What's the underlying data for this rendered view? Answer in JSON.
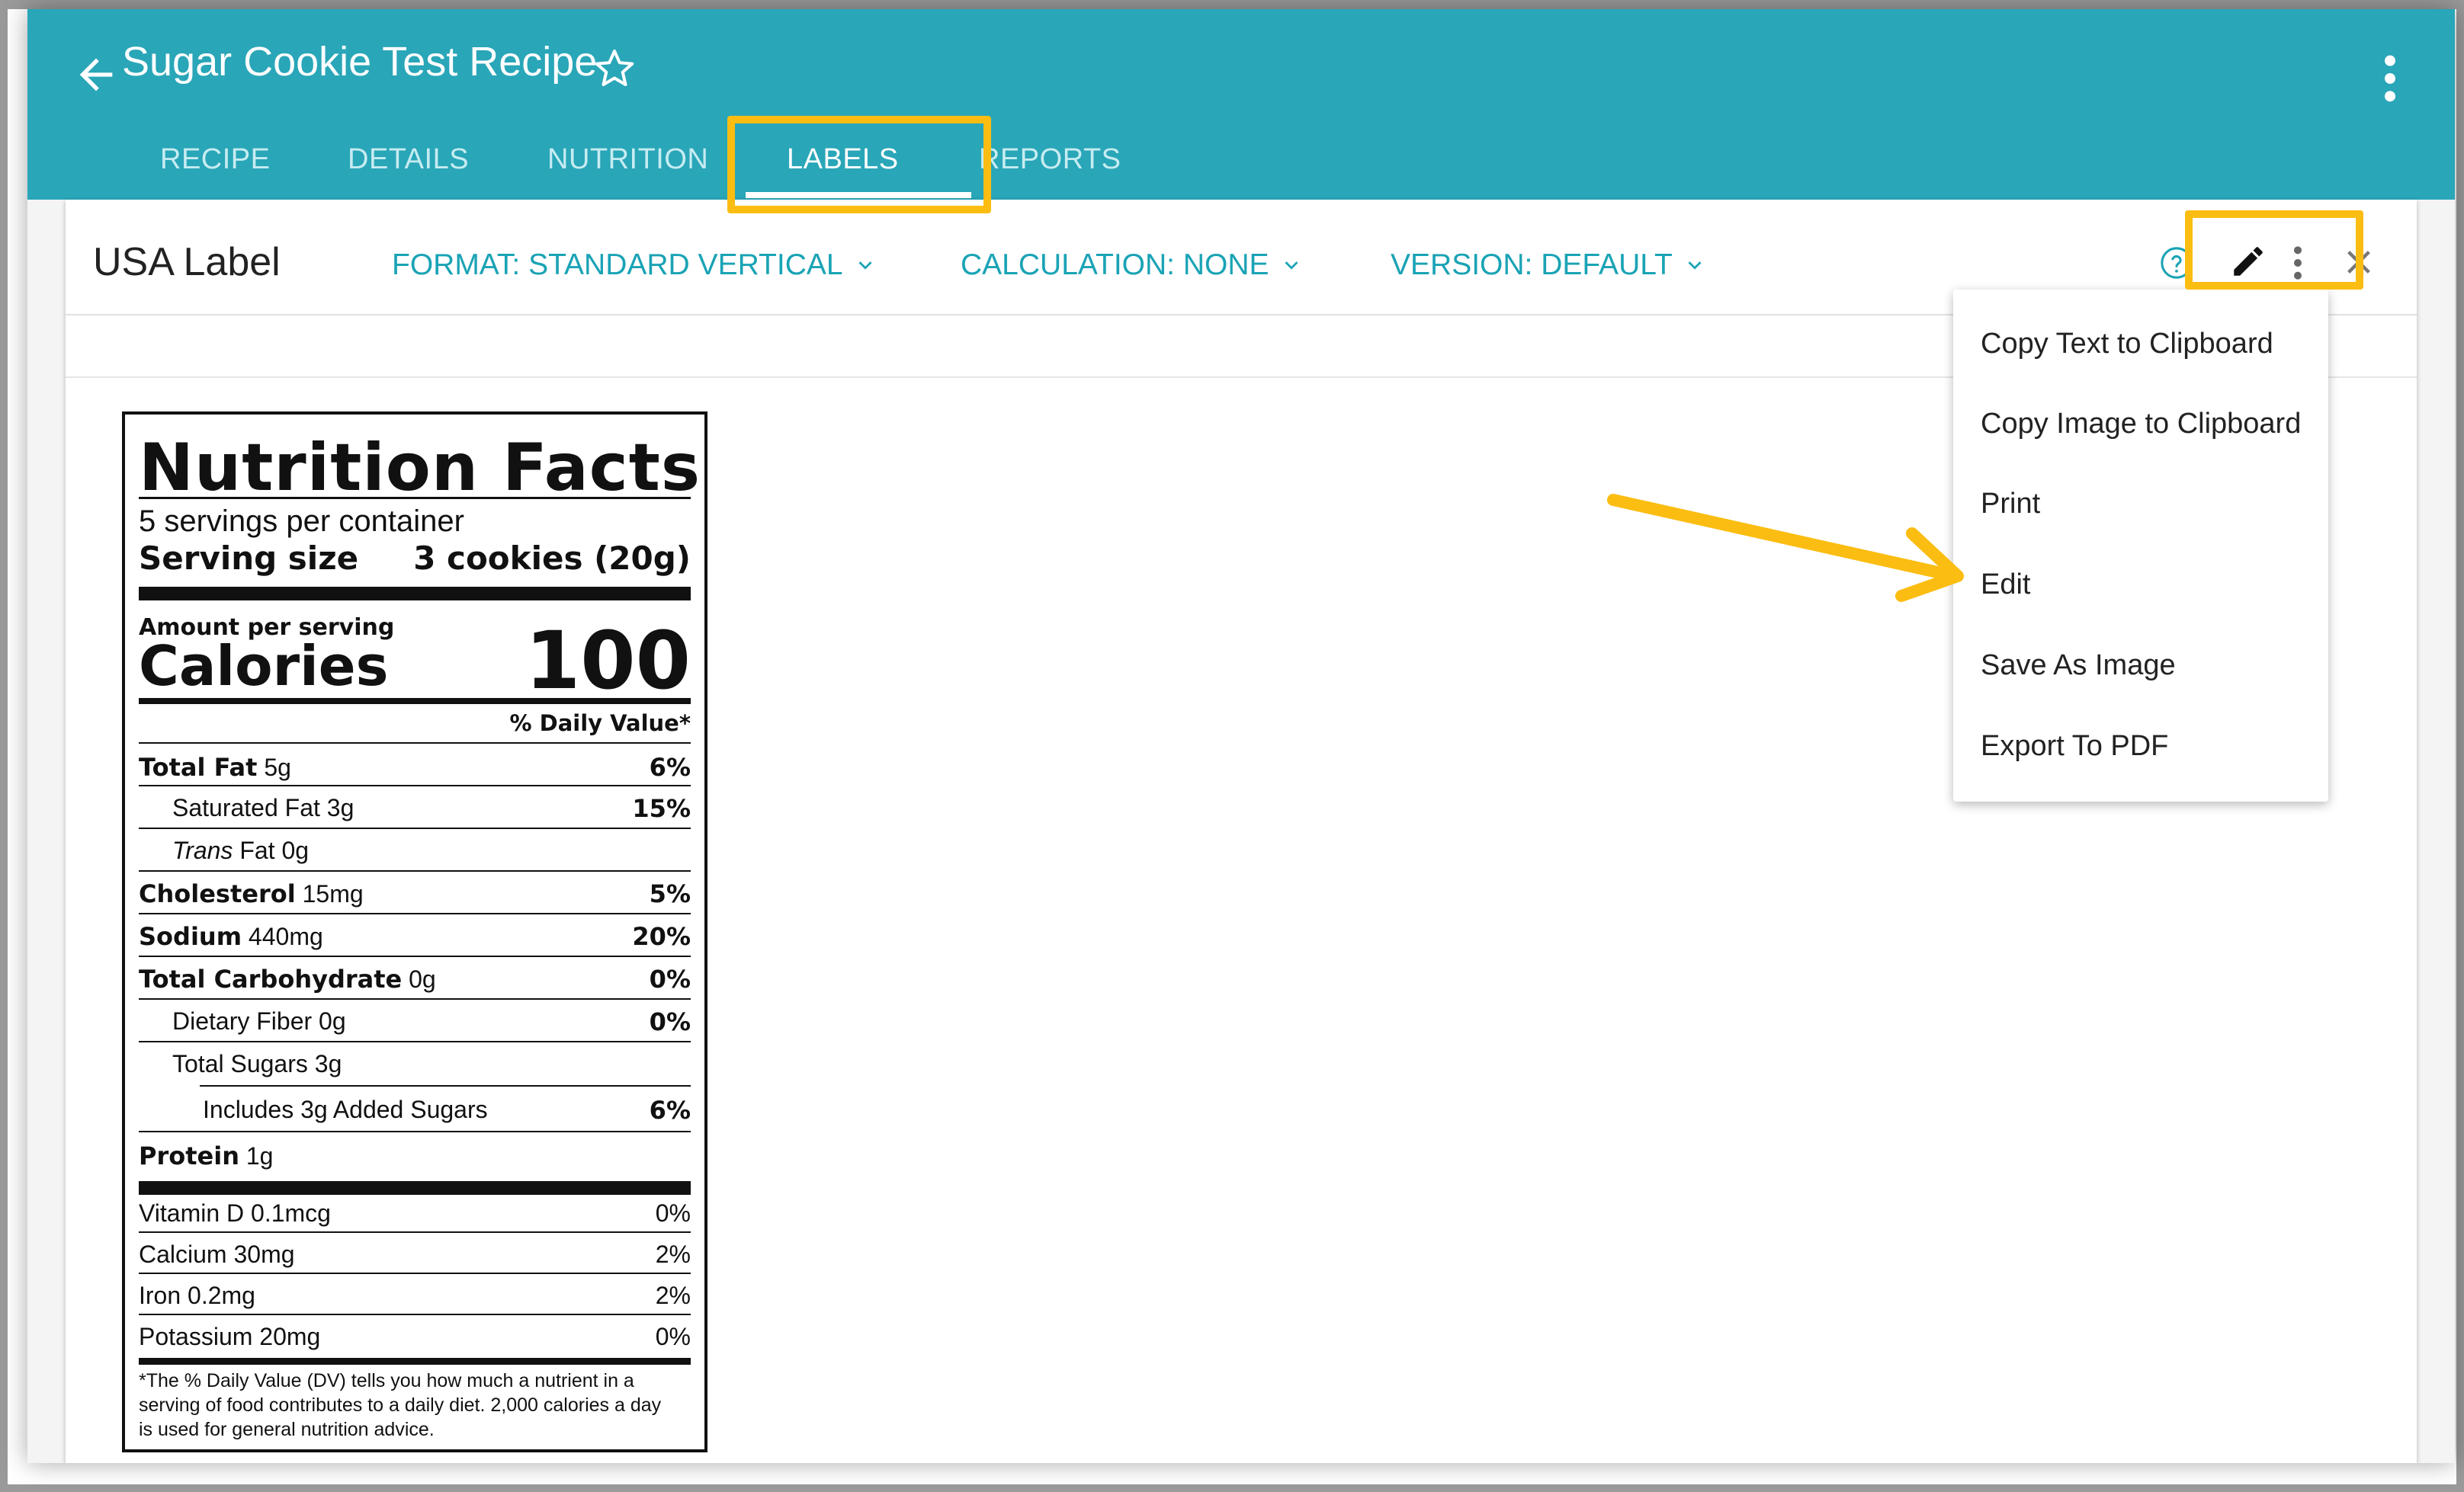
{
  "header": {
    "title": "Sugar Cookie Test Recipe",
    "tabs": [
      {
        "label": "RECIPE",
        "active": false
      },
      {
        "label": "DETAILS",
        "active": false
      },
      {
        "label": "NUTRITION",
        "active": false
      },
      {
        "label": "LABELS",
        "active": true
      },
      {
        "label": "REPORTS",
        "active": false
      }
    ]
  },
  "card": {
    "title": "USA Label",
    "format_label": "FORMAT: STANDARD VERTICAL",
    "calculation_label": "CALCULATION: NONE",
    "version_label": "VERSION: DEFAULT"
  },
  "menu": {
    "items": [
      "Copy Text to Clipboard",
      "Copy Image to Clipboard",
      "Print",
      "Edit",
      "Save As Image",
      "Export To PDF"
    ]
  },
  "label": {
    "title": "Nutrition Facts",
    "servings": "5 servings per container",
    "serving_size_label": "Serving size",
    "serving_size_value": "3 cookies (20g)",
    "amount_per_serving": "Amount per serving",
    "calories_label": "Calories",
    "calories_value": "100",
    "daily_value_header": "% Daily Value*",
    "nutrients": [
      {
        "name": "Total Fat",
        "amount": "5g",
        "dv": "6%"
      },
      {
        "name": "Saturated Fat",
        "amount": "3g",
        "dv": "15%"
      },
      {
        "name": "Trans",
        "name_rest": "Fat",
        "amount": "0g",
        "dv": ""
      },
      {
        "name": "Cholesterol",
        "amount": "15mg",
        "dv": "5%"
      },
      {
        "name": "Sodium",
        "amount": "440mg",
        "dv": "20%"
      },
      {
        "name": "Total Carbohydrate",
        "amount": "0g",
        "dv": "0%"
      },
      {
        "name": "Dietary Fiber",
        "amount": "0g",
        "dv": "0%"
      },
      {
        "name": "Total Sugars",
        "amount": "3g",
        "dv": ""
      },
      {
        "name": "Includes 3g Added Sugars",
        "amount": "",
        "dv": "6%"
      },
      {
        "name": "Protein",
        "amount": "1g",
        "dv": ""
      }
    ],
    "vitamins": [
      {
        "name": "Vitamin D 0.1mcg",
        "dv": "0%"
      },
      {
        "name": "Calcium 30mg",
        "dv": "2%"
      },
      {
        "name": "Iron 0.2mg",
        "dv": "2%"
      },
      {
        "name": "Potassium 20mg",
        "dv": "0%"
      }
    ],
    "footnote_1": "*The % Daily Value (DV) tells you how much a nutrient in a",
    "footnote_2": "serving of food contributes to a daily diet. 2,000 calories a day",
    "footnote_3": "is used for general nutrition advice."
  },
  "colors": {
    "header_bg": "#29a6b8",
    "accent": "#1aa3b5",
    "highlight": "#fbbd12"
  },
  "icons": [
    "back-arrow-icon",
    "star-outline-icon",
    "more-vert-icon",
    "chevron-down-icon",
    "help-icon",
    "pencil-icon",
    "close-icon"
  ]
}
